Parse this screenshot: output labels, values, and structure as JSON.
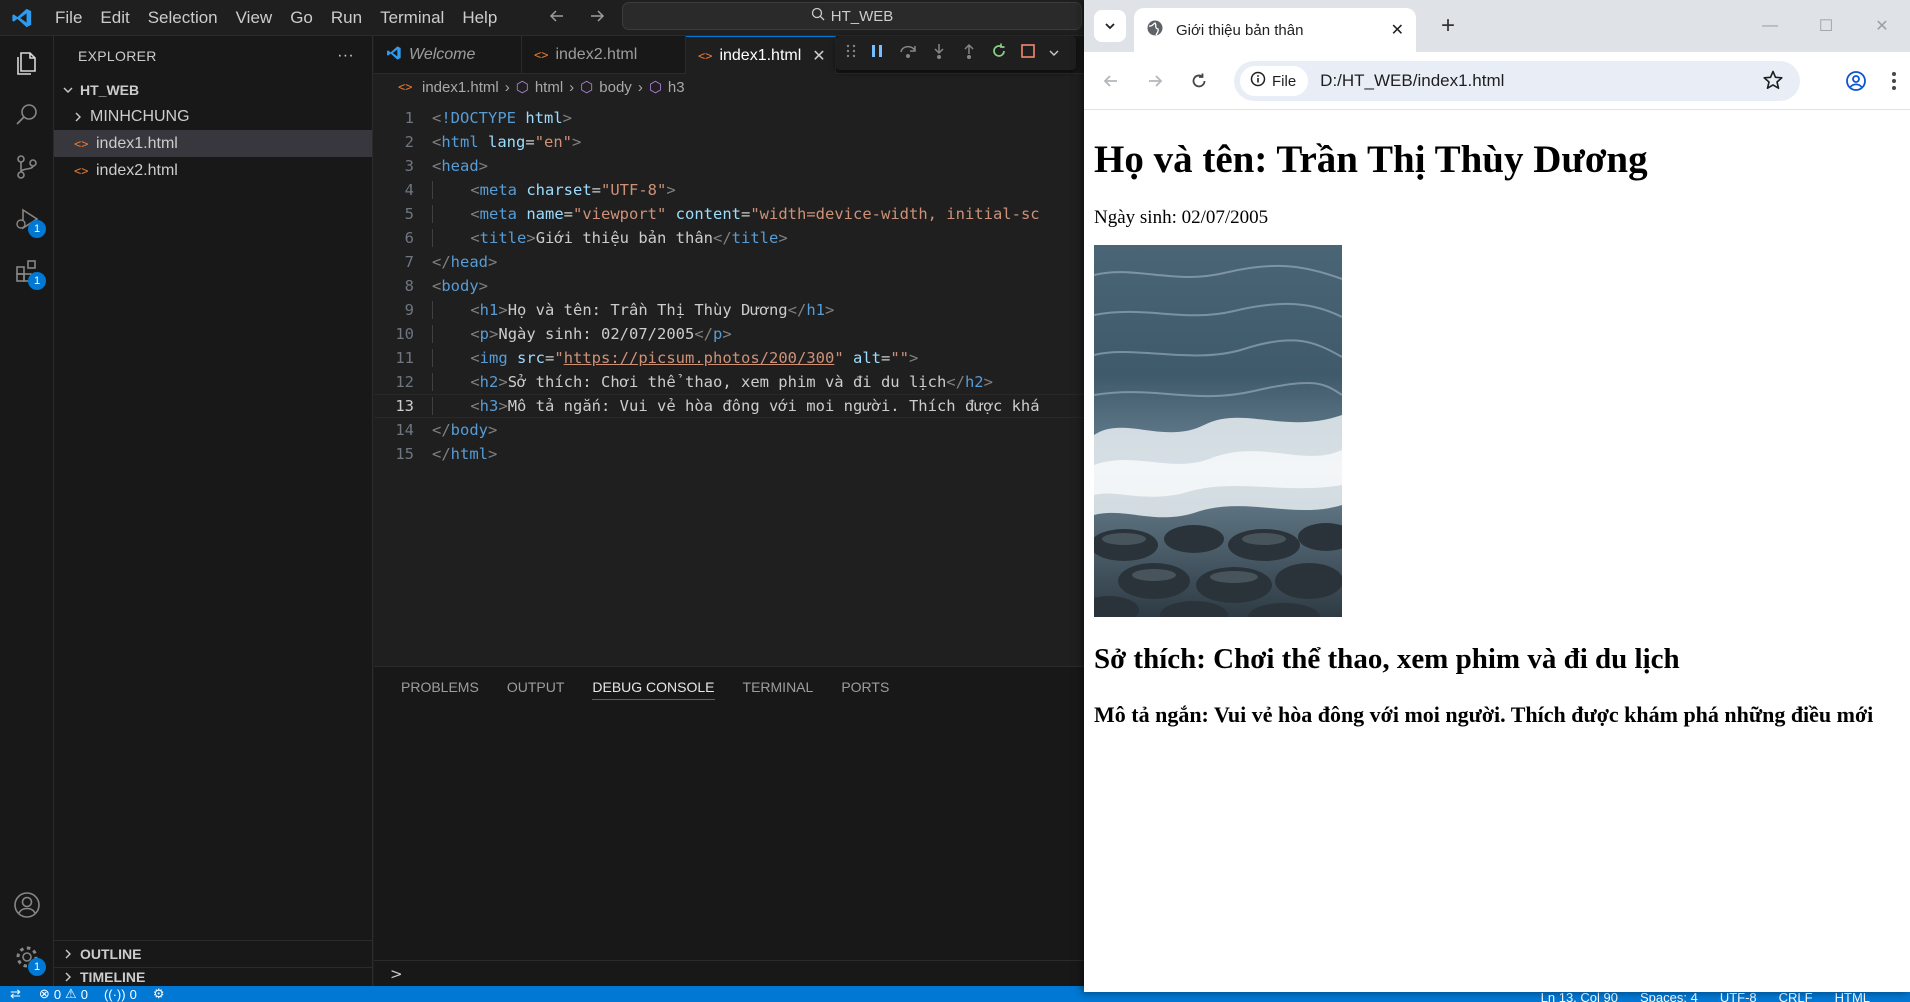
{
  "vscode": {
    "menu": [
      "File",
      "Edit",
      "Selection",
      "View",
      "Go",
      "Run",
      "Terminal",
      "Help"
    ],
    "command_center": "HT_WEB",
    "activity_badges": {
      "run_debug": "1",
      "extensions": "1",
      "settings": "1"
    },
    "sidebar": {
      "title": "EXPLORER",
      "more": "···",
      "root": "HT_WEB",
      "items": [
        {
          "label": "MINHCHUNG",
          "kind": "folder"
        },
        {
          "label": "index1.html",
          "kind": "file",
          "selected": true
        },
        {
          "label": "index2.html",
          "kind": "file"
        }
      ],
      "outline": "OUTLINE",
      "timeline": "TIMELINE"
    },
    "tabs": [
      {
        "label": "Welcome"
      },
      {
        "label": "index2.html"
      },
      {
        "label": "index1.html",
        "active": true
      }
    ],
    "breadcrumb": [
      "index1.html",
      "html",
      "body",
      "h3"
    ],
    "code": {
      "current_line": 13,
      "lines": [
        {
          "n": "1",
          "indent": 0,
          "tokens": [
            [
              "br",
              "<"
            ],
            [
              "doc",
              "!DOCTYPE "
            ],
            [
              "attr",
              "html"
            ],
            [
              "br",
              ">"
            ]
          ]
        },
        {
          "n": "2",
          "indent": 0,
          "tokens": [
            [
              "br",
              "<"
            ],
            [
              "tag",
              "html "
            ],
            [
              "attr",
              "lang"
            ],
            [
              "txt",
              "="
            ],
            [
              "str",
              "\"en\""
            ],
            [
              "br",
              ">"
            ]
          ]
        },
        {
          "n": "3",
          "indent": 0,
          "tokens": [
            [
              "br",
              "<"
            ],
            [
              "tag",
              "head"
            ],
            [
              "br",
              ">"
            ]
          ]
        },
        {
          "n": "4",
          "indent": 1,
          "tokens": [
            [
              "br",
              "<"
            ],
            [
              "tag",
              "meta "
            ],
            [
              "attr",
              "charset"
            ],
            [
              "txt",
              "="
            ],
            [
              "str",
              "\"UTF-8\""
            ],
            [
              "br",
              ">"
            ]
          ]
        },
        {
          "n": "5",
          "indent": 1,
          "tokens": [
            [
              "br",
              "<"
            ],
            [
              "tag",
              "meta "
            ],
            [
              "attr",
              "name"
            ],
            [
              "txt",
              "="
            ],
            [
              "str",
              "\"viewport\" "
            ],
            [
              "attr",
              "content"
            ],
            [
              "txt",
              "="
            ],
            [
              "str",
              "\"width=device-width, initial-sc"
            ]
          ]
        },
        {
          "n": "6",
          "indent": 1,
          "tokens": [
            [
              "br",
              "<"
            ],
            [
              "tag",
              "title"
            ],
            [
              "br",
              ">"
            ],
            [
              "txt",
              "Giới thiệu bản thân"
            ],
            [
              "br",
              "</"
            ],
            [
              "tag",
              "title"
            ],
            [
              "br",
              ">"
            ]
          ]
        },
        {
          "n": "7",
          "indent": 0,
          "tokens": [
            [
              "br",
              "</"
            ],
            [
              "tag",
              "head"
            ],
            [
              "br",
              ">"
            ]
          ]
        },
        {
          "n": "8",
          "indent": 0,
          "tokens": [
            [
              "br",
              "<"
            ],
            [
              "tag",
              "body"
            ],
            [
              "br",
              ">"
            ]
          ]
        },
        {
          "n": "9",
          "indent": 1,
          "tokens": [
            [
              "br",
              "<"
            ],
            [
              "tag",
              "h1"
            ],
            [
              "br",
              ">"
            ],
            [
              "txt",
              "Họ và tên: Trần Thị Thùy Dương"
            ],
            [
              "br",
              "</"
            ],
            [
              "tag",
              "h1"
            ],
            [
              "br",
              ">"
            ]
          ]
        },
        {
          "n": "10",
          "indent": 1,
          "tokens": [
            [
              "br",
              "<"
            ],
            [
              "tag",
              "p"
            ],
            [
              "br",
              ">"
            ],
            [
              "txt",
              "Ngày sinh: 02/07/2005"
            ],
            [
              "br",
              "</"
            ],
            [
              "tag",
              "p"
            ],
            [
              "br",
              ">"
            ]
          ]
        },
        {
          "n": "11",
          "indent": 1,
          "tokens": [
            [
              "br",
              "<"
            ],
            [
              "tag",
              "img "
            ],
            [
              "attr",
              "src"
            ],
            [
              "txt",
              "="
            ],
            [
              "str",
              "\""
            ],
            [
              "link",
              "https://picsum.photos/200/300"
            ],
            [
              "str",
              "\" "
            ],
            [
              "attr",
              "alt"
            ],
            [
              "txt",
              "="
            ],
            [
              "str",
              "\"\""
            ],
            [
              "br",
              ">"
            ]
          ]
        },
        {
          "n": "12",
          "indent": 1,
          "tokens": [
            [
              "br",
              "<"
            ],
            [
              "tag",
              "h2"
            ],
            [
              "br",
              ">"
            ],
            [
              "txt",
              "Sở thích: Chơi thể thao, xem phim và đi du lịch"
            ],
            [
              "br",
              "</"
            ],
            [
              "tag",
              "h2"
            ],
            [
              "br",
              ">"
            ]
          ]
        },
        {
          "n": "13",
          "indent": 1,
          "tokens": [
            [
              "br",
              "<"
            ],
            [
              "tag",
              "h3"
            ],
            [
              "br",
              ">"
            ],
            [
              "txt",
              "Mô tả ngắn: Vui vẻ hòa đông với moi người. Thích được khá"
            ]
          ]
        },
        {
          "n": "14",
          "indent": 0,
          "tokens": [
            [
              "br",
              "</"
            ],
            [
              "tag",
              "body"
            ],
            [
              "br",
              ">"
            ]
          ]
        },
        {
          "n": "15",
          "indent": 0,
          "tokens": [
            [
              "br",
              "</"
            ],
            [
              "tag",
              "html"
            ],
            [
              "br",
              ">"
            ]
          ]
        }
      ]
    },
    "panel_tabs": [
      {
        "label": "PROBLEMS"
      },
      {
        "label": "OUTPUT"
      },
      {
        "label": "DEBUG CONSOLE",
        "active": true
      },
      {
        "label": "TERMINAL"
      },
      {
        "label": "PORTS"
      }
    ],
    "panel_prompt": ">",
    "status": {
      "errors": "0",
      "warnings": "0",
      "ports": "0",
      "position": "Ln 13, Col 90",
      "spaces": "Spaces: 4",
      "encoding": "UTF-8",
      "eol": "CRLF",
      "language": "HTML"
    }
  },
  "browser": {
    "tab_title": "Giới thiệu bản thân",
    "site_chip": "File",
    "url": "D:/HT_WEB/index1.html",
    "page": {
      "h1": "Họ và tên: Trần Thị Thùy Dương",
      "p": "Ngày sinh: 02/07/2005",
      "h2": "Sở thích: Chơi thể thao, xem phim và đi du lịch",
      "h3": "Mô tả ngắn: Vui vẻ hòa đông với moi người. Thích được khám phá những điều mới"
    }
  },
  "colors": {
    "accent": "#0078d4",
    "editor_bg": "#1f1f1f",
    "sidebar_bg": "#181818",
    "html_icon": "#e37933"
  }
}
